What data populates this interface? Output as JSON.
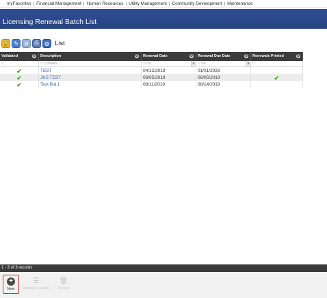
{
  "nav": {
    "items": [
      "myFavorites",
      "Financial Management",
      "Human Resources",
      "Utility Management",
      "Community Development",
      "Maintenance"
    ],
    "separator": "|"
  },
  "page": {
    "title": "Licensing Renewal Batch List"
  },
  "toolbar": {
    "icons": [
      "lock-icon",
      "pencil-icon",
      "no-entry-icon",
      "printer-icon",
      "globe-icon"
    ],
    "list_label": "List"
  },
  "grid": {
    "columns": [
      "Validated",
      "Description",
      "Renewal Date",
      "Renewal Due Date",
      "Renewals Printed"
    ],
    "column_menu_glyph": "⚙",
    "filter_icon": "▽",
    "filters": {
      "validated": "",
      "description": "Contains...",
      "renewal_date": "On...",
      "renewal_due_date": "On...",
      "renewals_printed": ""
    },
    "rows": [
      {
        "validated": true,
        "description": "TEST",
        "renewal_date": "04/12/2019",
        "renewal_due_date": "01/01/2026",
        "renewals_printed": false
      },
      {
        "validated": true,
        "description": "JKS TEST",
        "renewal_date": "06/05/2019",
        "renewal_due_date": "06/05/2019",
        "renewals_printed": true
      },
      {
        "validated": true,
        "description": "Test Bid 1",
        "renewal_date": "08/11/2019",
        "renewal_due_date": "08/14/2019",
        "renewals_printed": false
      }
    ]
  },
  "status": {
    "records": "1 - 3 of 3 records"
  },
  "actions": {
    "new_label": "New",
    "maintain_label": "Maintain Results",
    "delete_label": "Delete"
  },
  "colors": {
    "title_bar": "#2f4f95",
    "grid_header": "#3b3b3b",
    "check": "#42a82a",
    "link": "#2d5fa8",
    "new_highlight": "#d92626"
  }
}
